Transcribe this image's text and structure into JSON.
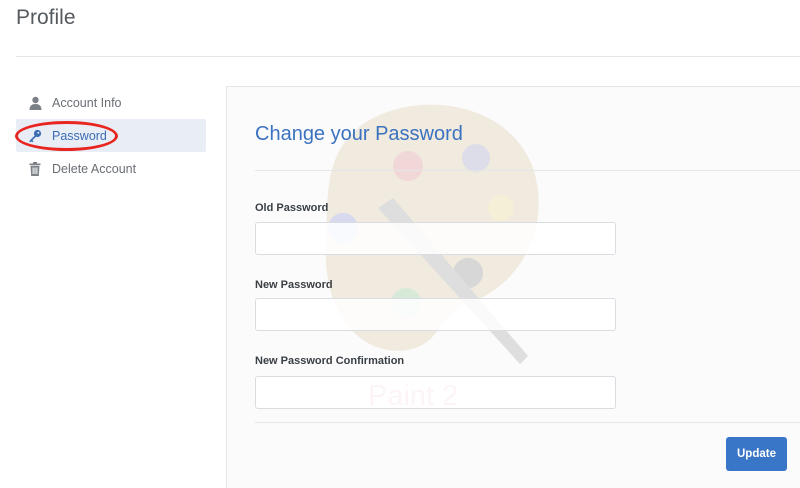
{
  "page": {
    "title": "Profile"
  },
  "sidebar": {
    "items": [
      {
        "label": "Account Info",
        "icon": "user-icon"
      },
      {
        "label": "Password",
        "icon": "key-icon",
        "active": true
      },
      {
        "label": "Delete Account",
        "icon": "trash-icon"
      }
    ]
  },
  "form": {
    "title": "Change your Password",
    "fields": [
      {
        "label": "Old Password",
        "value": "",
        "placeholder": ""
      },
      {
        "label": "New Password",
        "value": "",
        "placeholder": ""
      },
      {
        "label": "New Password Confirmation",
        "value": "",
        "placeholder": ""
      }
    ],
    "submit_label": "Update"
  },
  "watermark": {
    "text": "Paint 2"
  },
  "colors": {
    "accent": "#3a76c8",
    "active_bg": "#e8edf6",
    "highlight": "#e8261f"
  }
}
